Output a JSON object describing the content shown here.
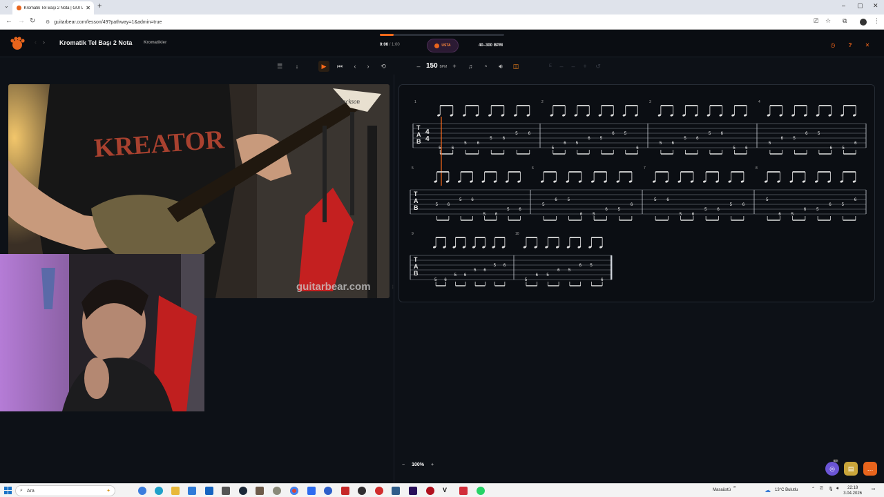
{
  "browser": {
    "tab_title": "Kromatik Tel Başı 2 Nota | GUITA",
    "new_tab": "+",
    "url": "guitarbear.com/lesson/49?pathway=1&admin=true",
    "win_min": "–",
    "win_max": "▢",
    "win_close": "✕"
  },
  "header": {
    "back": "‹",
    "forward": "›",
    "lesson_title": "Kromatik Tel Başı 2 Nota",
    "lesson_category": "Kromatikler",
    "current_time": "0:06",
    "time_sep": "/",
    "total_time": "1:00",
    "progress_fraction": 0.11,
    "level_badge": "USTA",
    "bpm_range": "40–300 BPM",
    "accent": "#ff6a1a"
  },
  "toolbar": {
    "tempo_minus": "–",
    "tempo_value": "150",
    "tempo_unit": "BPM",
    "tempo_plus": "+"
  },
  "video": {
    "watermark": "guitarbear.com",
    "brand_on_guitar": "Jackson"
  },
  "tab": {
    "tuning_letters": [
      "T",
      "A",
      "B"
    ],
    "time_signature": [
      "4",
      "4"
    ],
    "measure_numbers": [
      "1",
      "2",
      "3",
      "4",
      "5",
      "6",
      "7",
      "8",
      "9",
      "10"
    ]
  },
  "zoom": {
    "minus": "−",
    "value": "100%",
    "plus": "+"
  },
  "taskbar": {
    "search_placeholder": "Ara",
    "desktop_label": "Masaüstü",
    "weather": "13°C Bulutlu",
    "time": "22:18",
    "date": "3.04.2026"
  },
  "floating": {
    "badge_count": "9/9"
  }
}
